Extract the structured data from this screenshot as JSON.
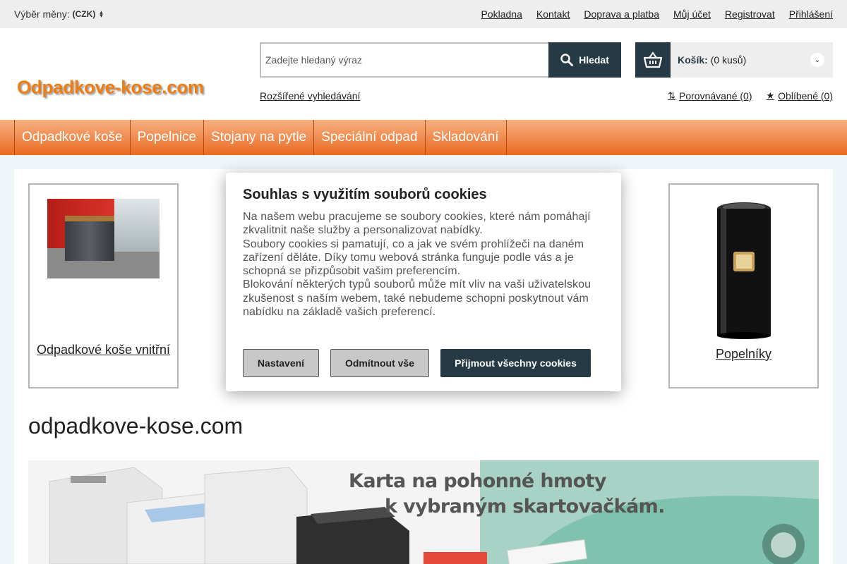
{
  "topbar": {
    "currency_label": "Výběr měny:",
    "currency_value": "(CZK)",
    "links": [
      "Pokladna",
      "Kontakt",
      "Doprava a platba",
      "Můj účet",
      "Registrovat",
      "Přihlášení"
    ]
  },
  "header": {
    "logo_text": "Odpadkove-kose.com",
    "search_placeholder": "Zadejte hledaný výraz",
    "search_button": "Hledat",
    "advanced_search": "Rozšířené vyhledávání",
    "cart_label": "Košík:",
    "cart_count": "(0 kusů)",
    "compare_link": "Porovnávané (0)",
    "favorites_link": "Oblíbené (0)"
  },
  "nav": {
    "items": [
      "Odpadkové koše",
      "Popelnice",
      "Stojany na pytle",
      "Speciální odpad",
      "Skladování"
    ]
  },
  "content": {
    "card_left_label": "Odpadkové koše vnitřní",
    "card_right_label": "Popelníky",
    "page_title": "odpadkove-kose.com",
    "banner_line1": "Karta na pohonné hmoty",
    "banner_line2": "k vybraným skartovačkám."
  },
  "cookie_modal": {
    "title": "Souhlas s využitím souborů cookies",
    "paragraph1": "Na našem webu pracujeme se soubory cookies, které nám pomáhají zkvalitnit naše služby a personalizovat nabídky.",
    "paragraph2": "Soubory cookies si pamatují, co a jak ve svém prohlížeči na daném zařízení děláte. Díky tomu webová stránka funguje podle vás a je schopná se přizpůsobit vašim preferencím.",
    "paragraph3": "Blokování některých typů souborů může mít vliv na vaši uživatelskou zkušenost s naším webem, také nebudeme schopni poskytnout vám nabídku na základě vašich preferencí.",
    "btn_settings": "Nastavení",
    "btn_reject": "Odmítnout vše",
    "btn_accept": "Přijmout všechny cookies"
  },
  "colors": {
    "accent_dark": "#253a45",
    "nav_orange": "#e96a1f",
    "logo_orange": "#ef7d12"
  }
}
